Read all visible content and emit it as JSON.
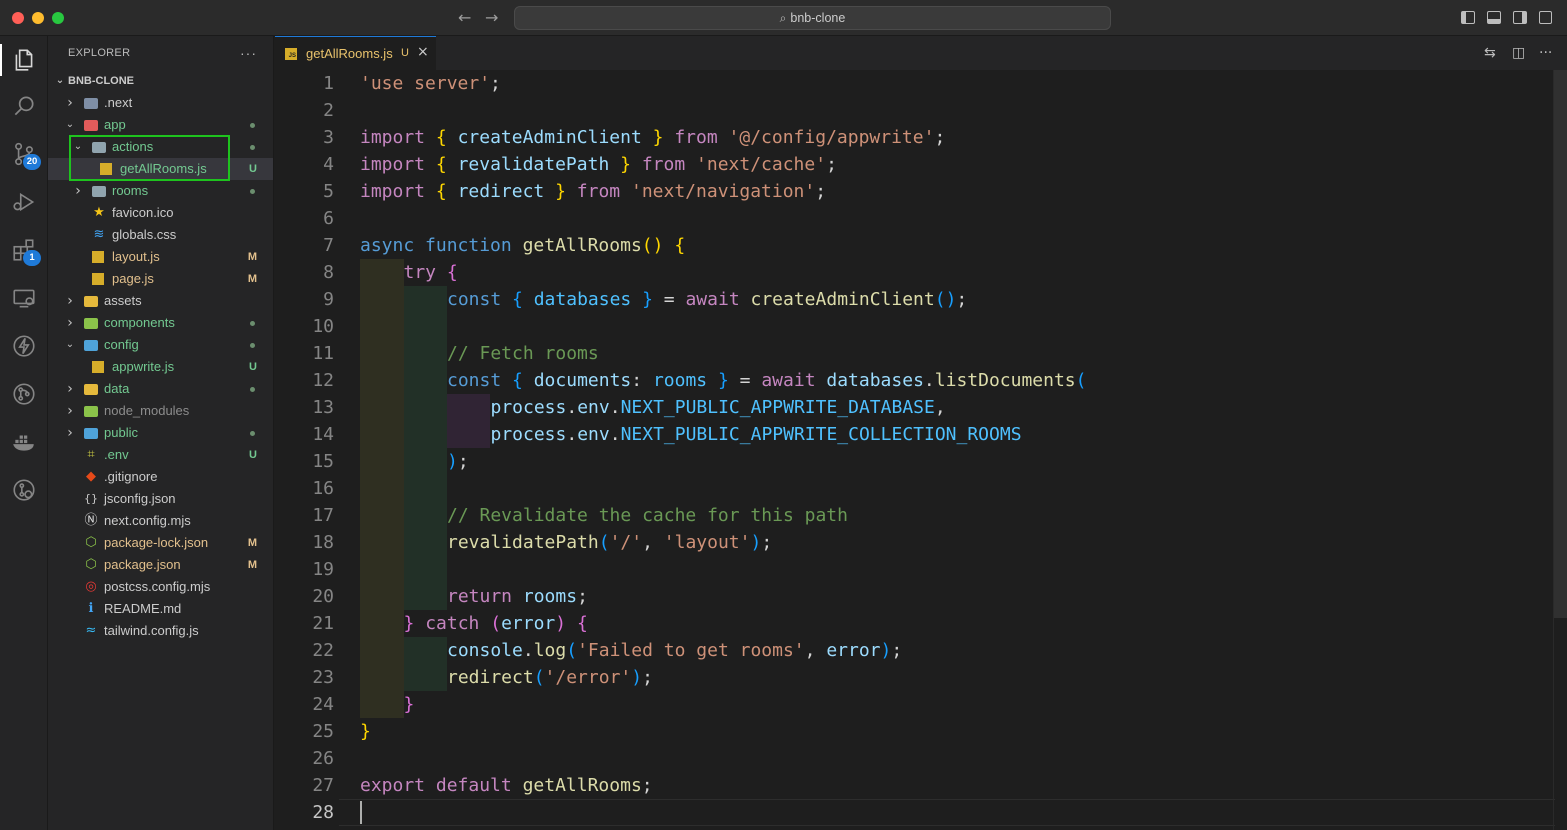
{
  "window": {
    "search_label": "bnb-clone"
  },
  "activity_bar": {
    "items": [
      {
        "name": "explorer",
        "badge": ""
      },
      {
        "name": "search",
        "badge": ""
      },
      {
        "name": "source-control",
        "badge": "20"
      },
      {
        "name": "run-debug",
        "badge": ""
      },
      {
        "name": "extensions",
        "badge": "1"
      },
      {
        "name": "remote-explorer",
        "badge": ""
      },
      {
        "name": "thunder-client",
        "badge": ""
      },
      {
        "name": "gitlens",
        "badge": ""
      },
      {
        "name": "docker",
        "badge": ""
      },
      {
        "name": "git-graph",
        "badge": ""
      }
    ]
  },
  "explorer": {
    "title": "EXPLORER",
    "more": "···",
    "project": "BNB-CLONE",
    "tree": [
      {
        "label": ".next",
        "depth": 0,
        "kind": "folder",
        "expanded": false,
        "color": "#cccccc",
        "icon": "gear-folder",
        "mark": ""
      },
      {
        "label": "app",
        "depth": 0,
        "kind": "folder",
        "expanded": true,
        "color": "#73c991",
        "icon": "red-folder",
        "mark": "dot"
      },
      {
        "label": "actions",
        "depth": 1,
        "kind": "folder",
        "expanded": true,
        "color": "#73c991",
        "icon": "folder",
        "mark": "dot"
      },
      {
        "label": "getAllRooms.js",
        "depth": 2,
        "kind": "js",
        "expanded": false,
        "color": "#73c991",
        "icon": "js",
        "mark": "U",
        "selected": true
      },
      {
        "label": "rooms",
        "depth": 1,
        "kind": "folder",
        "expanded": false,
        "color": "#73c991",
        "icon": "folder",
        "mark": "dot"
      },
      {
        "label": "favicon.ico",
        "depth": 1,
        "kind": "file",
        "expanded": false,
        "color": "#cccccc",
        "icon": "star",
        "mark": ""
      },
      {
        "label": "globals.css",
        "depth": 1,
        "kind": "file",
        "expanded": false,
        "color": "#cccccc",
        "icon": "css",
        "mark": ""
      },
      {
        "label": "layout.js",
        "depth": 1,
        "kind": "js",
        "expanded": false,
        "color": "#e2c08d",
        "icon": "js",
        "mark": "M"
      },
      {
        "label": "page.js",
        "depth": 1,
        "kind": "js",
        "expanded": false,
        "color": "#e2c08d",
        "icon": "js",
        "mark": "M"
      },
      {
        "label": "assets",
        "depth": 0,
        "kind": "folder",
        "expanded": false,
        "color": "#cccccc",
        "icon": "yellow-folder",
        "mark": ""
      },
      {
        "label": "components",
        "depth": 0,
        "kind": "folder",
        "expanded": false,
        "color": "#73c991",
        "icon": "green-folder",
        "mark": "dot"
      },
      {
        "label": "config",
        "depth": 0,
        "kind": "folder",
        "expanded": true,
        "color": "#73c991",
        "icon": "blue-folder",
        "mark": "dot"
      },
      {
        "label": "appwrite.js",
        "depth": 1,
        "kind": "js",
        "expanded": false,
        "color": "#73c991",
        "icon": "js",
        "mark": "U"
      },
      {
        "label": "data",
        "depth": 0,
        "kind": "folder",
        "expanded": false,
        "color": "#73c991",
        "icon": "yellow-folder",
        "mark": "dot"
      },
      {
        "label": "node_modules",
        "depth": 0,
        "kind": "folder",
        "expanded": false,
        "color": "#8c8c8c",
        "icon": "green-folder",
        "mark": ""
      },
      {
        "label": "public",
        "depth": 0,
        "kind": "folder",
        "expanded": false,
        "color": "#73c991",
        "icon": "blue-folder",
        "mark": "dot"
      },
      {
        "label": ".env",
        "depth": 0,
        "kind": "file",
        "expanded": false,
        "color": "#73c991",
        "icon": "env",
        "mark": "U"
      },
      {
        "label": ".gitignore",
        "depth": 0,
        "kind": "file",
        "expanded": false,
        "color": "#cccccc",
        "icon": "git",
        "mark": ""
      },
      {
        "label": "jsconfig.json",
        "depth": 0,
        "kind": "file",
        "expanded": false,
        "color": "#cccccc",
        "icon": "jsconfig",
        "mark": ""
      },
      {
        "label": "next.config.mjs",
        "depth": 0,
        "kind": "file",
        "expanded": false,
        "color": "#cccccc",
        "icon": "next",
        "mark": ""
      },
      {
        "label": "package-lock.json",
        "depth": 0,
        "kind": "file",
        "expanded": false,
        "color": "#e2c08d",
        "icon": "npm",
        "mark": "M"
      },
      {
        "label": "package.json",
        "depth": 0,
        "kind": "file",
        "expanded": false,
        "color": "#e2c08d",
        "icon": "npm",
        "mark": "M"
      },
      {
        "label": "postcss.config.mjs",
        "depth": 0,
        "kind": "file",
        "expanded": false,
        "color": "#cccccc",
        "icon": "postcss",
        "mark": ""
      },
      {
        "label": "README.md",
        "depth": 0,
        "kind": "file",
        "expanded": false,
        "color": "#cccccc",
        "icon": "info",
        "mark": ""
      },
      {
        "label": "tailwind.config.js",
        "depth": 0,
        "kind": "file",
        "expanded": false,
        "color": "#cccccc",
        "icon": "tailwind",
        "mark": ""
      }
    ]
  },
  "tab": {
    "label": "getAllRooms.js",
    "status": "U",
    "close": "×"
  },
  "editor": {
    "current_line": 28,
    "lines": [
      {
        "tokens": [
          [
            "str",
            "'use server'"
          ],
          [
            "",
            ";"
          ]
        ]
      },
      {
        "tokens": []
      },
      {
        "tokens": [
          [
            "ctrl",
            "import"
          ],
          [
            "",
            " "
          ],
          [
            "br1",
            "{"
          ],
          [
            "",
            " "
          ],
          [
            "var",
            "createAdminClient"
          ],
          [
            "",
            " "
          ],
          [
            "br1",
            "}"
          ],
          [
            "",
            " "
          ],
          [
            "ctrl",
            "from"
          ],
          [
            "",
            " "
          ],
          [
            "str",
            "'@/config/appwrite'"
          ],
          [
            "",
            ";"
          ]
        ]
      },
      {
        "tokens": [
          [
            "ctrl",
            "import"
          ],
          [
            "",
            " "
          ],
          [
            "br1",
            "{"
          ],
          [
            "",
            " "
          ],
          [
            "var",
            "revalidatePath"
          ],
          [
            "",
            " "
          ],
          [
            "br1",
            "}"
          ],
          [
            "",
            " "
          ],
          [
            "ctrl",
            "from"
          ],
          [
            "",
            " "
          ],
          [
            "str",
            "'next/cache'"
          ],
          [
            "",
            ";"
          ]
        ]
      },
      {
        "tokens": [
          [
            "ctrl",
            "import"
          ],
          [
            "",
            " "
          ],
          [
            "br1",
            "{"
          ],
          [
            "",
            " "
          ],
          [
            "var",
            "redirect"
          ],
          [
            "",
            " "
          ],
          [
            "br1",
            "}"
          ],
          [
            "",
            " "
          ],
          [
            "ctrl",
            "from"
          ],
          [
            "",
            " "
          ],
          [
            "str",
            "'next/navigation'"
          ],
          [
            "",
            ";"
          ]
        ]
      },
      {
        "tokens": []
      },
      {
        "tokens": [
          [
            "kw",
            "async"
          ],
          [
            "",
            " "
          ],
          [
            "kw",
            "function"
          ],
          [
            "",
            " "
          ],
          [
            "fn",
            "getAllRooms"
          ],
          [
            "br1",
            "()"
          ],
          [
            "",
            " "
          ],
          [
            "br1",
            "{"
          ]
        ]
      },
      {
        "indent": 1,
        "tokens": [
          [
            "ctrl",
            "try"
          ],
          [
            "",
            " "
          ],
          [
            "br2",
            "{"
          ]
        ]
      },
      {
        "indent": 2,
        "tokens": [
          [
            "kw",
            "const"
          ],
          [
            "",
            " "
          ],
          [
            "br3",
            "{"
          ],
          [
            "",
            " "
          ],
          [
            "const",
            "databases"
          ],
          [
            "",
            " "
          ],
          [
            "br3",
            "}"
          ],
          [
            "",
            " = "
          ],
          [
            "ctrl",
            "await"
          ],
          [
            "",
            " "
          ],
          [
            "fn",
            "createAdminClient"
          ],
          [
            "br3",
            "()"
          ],
          [
            "",
            ";"
          ]
        ]
      },
      {
        "indent": 0,
        "guides": 2,
        "tokens": []
      },
      {
        "indent": 2,
        "tokens": [
          [
            "cmt",
            "// Fetch rooms"
          ]
        ]
      },
      {
        "indent": 2,
        "tokens": [
          [
            "kw",
            "const"
          ],
          [
            "",
            " "
          ],
          [
            "br3",
            "{"
          ],
          [
            "",
            " "
          ],
          [
            "var",
            "documents"
          ],
          [
            "",
            ": "
          ],
          [
            "const",
            "rooms"
          ],
          [
            "",
            " "
          ],
          [
            "br3",
            "}"
          ],
          [
            "",
            " = "
          ],
          [
            "ctrl",
            "await"
          ],
          [
            "",
            " "
          ],
          [
            "var",
            "databases"
          ],
          [
            "",
            "."
          ],
          [
            "fn",
            "listDocuments"
          ],
          [
            "br3",
            "("
          ]
        ]
      },
      {
        "indent": 3,
        "tokens": [
          [
            "var",
            "process"
          ],
          [
            "",
            "."
          ],
          [
            "var",
            "env"
          ],
          [
            "",
            "."
          ],
          [
            "const",
            "NEXT_PUBLIC_APPWRITE_DATABASE"
          ],
          [
            "",
            ","
          ]
        ]
      },
      {
        "indent": 3,
        "tokens": [
          [
            "var",
            "process"
          ],
          [
            "",
            "."
          ],
          [
            "var",
            "env"
          ],
          [
            "",
            "."
          ],
          [
            "const",
            "NEXT_PUBLIC_APPWRITE_COLLECTION_ROOMS"
          ]
        ]
      },
      {
        "indent": 2,
        "tokens": [
          [
            "br3",
            ")"
          ],
          [
            "",
            ";"
          ]
        ]
      },
      {
        "indent": 0,
        "guides": 2,
        "tokens": []
      },
      {
        "indent": 2,
        "tokens": [
          [
            "cmt",
            "// Revalidate the cache for this path"
          ]
        ]
      },
      {
        "indent": 2,
        "tokens": [
          [
            "fn",
            "revalidatePath"
          ],
          [
            "br3",
            "("
          ],
          [
            "str",
            "'/'"
          ],
          [
            "",
            ", "
          ],
          [
            "str",
            "'layout'"
          ],
          [
            "br3",
            ")"
          ],
          [
            "",
            ";"
          ]
        ]
      },
      {
        "indent": 0,
        "guides": 2,
        "tokens": []
      },
      {
        "indent": 2,
        "tokens": [
          [
            "ctrl",
            "return"
          ],
          [
            "",
            " "
          ],
          [
            "var",
            "rooms"
          ],
          [
            "",
            ";"
          ]
        ]
      },
      {
        "indent": 1,
        "tokens": [
          [
            "br2",
            "}"
          ],
          [
            "",
            " "
          ],
          [
            "ctrl",
            "catch"
          ],
          [
            "",
            " "
          ],
          [
            "br2",
            "("
          ],
          [
            "var",
            "error"
          ],
          [
            "br2",
            ")"
          ],
          [
            "",
            " "
          ],
          [
            "br2",
            "{"
          ]
        ]
      },
      {
        "indent": 2,
        "tokens": [
          [
            "var",
            "console"
          ],
          [
            "",
            "."
          ],
          [
            "fn",
            "log"
          ],
          [
            "br3",
            "("
          ],
          [
            "str",
            "'Failed to get rooms'"
          ],
          [
            "",
            ", "
          ],
          [
            "var",
            "error"
          ],
          [
            "br3",
            ")"
          ],
          [
            "",
            ";"
          ]
        ]
      },
      {
        "indent": 2,
        "tokens": [
          [
            "fn",
            "redirect"
          ],
          [
            "br3",
            "("
          ],
          [
            "str",
            "'/error'"
          ],
          [
            "br3",
            ")"
          ],
          [
            "",
            ";"
          ]
        ]
      },
      {
        "indent": 1,
        "tokens": [
          [
            "br2",
            "}"
          ]
        ]
      },
      {
        "tokens": [
          [
            "br1",
            "}"
          ]
        ]
      },
      {
        "tokens": []
      },
      {
        "tokens": [
          [
            "ctrl",
            "export"
          ],
          [
            "",
            " "
          ],
          [
            "ctrl",
            "default"
          ],
          [
            "",
            " "
          ],
          [
            "fn",
            "getAllRooms"
          ],
          [
            "",
            ";"
          ]
        ]
      },
      {
        "tokens": []
      }
    ]
  }
}
